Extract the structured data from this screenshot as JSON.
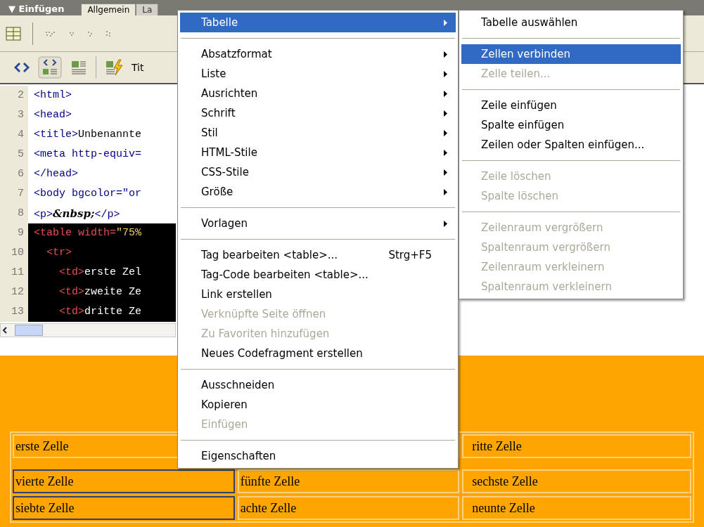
{
  "panel_header": {
    "title": "▼ Einfügen",
    "tabs": [
      {
        "label": "Allgemein",
        "selected": true
      },
      {
        "label": "La",
        "selected": false
      }
    ]
  },
  "toolbar_2": {
    "label": "Tit"
  },
  "code_lines": [
    {
      "number": "2",
      "selected": false,
      "segments": [
        {
          "kind": "tag",
          "text": "<html>"
        }
      ]
    },
    {
      "number": "3",
      "selected": false,
      "segments": [
        {
          "kind": "tag",
          "text": "<head>"
        }
      ]
    },
    {
      "number": "4",
      "selected": false,
      "segments": [
        {
          "kind": "tag",
          "text": "<title>"
        },
        {
          "kind": "text",
          "text": "Unbenannte"
        }
      ]
    },
    {
      "number": "5",
      "selected": false,
      "segments": [
        {
          "kind": "tag",
          "text": "<meta http-equiv="
        }
      ]
    },
    {
      "number": "6",
      "selected": false,
      "segments": [
        {
          "kind": "tag",
          "text": "</head>"
        }
      ]
    },
    {
      "number": "7",
      "selected": false,
      "segments": [
        {
          "kind": "tag",
          "text": "<body bgcolor=\"or"
        }
      ]
    },
    {
      "number": "8",
      "selected": false,
      "segments": [
        {
          "kind": "tag",
          "text": "<p>"
        },
        {
          "kind": "entity",
          "text": "&nbsp;"
        },
        {
          "kind": "tag",
          "text": "</p>"
        }
      ]
    },
    {
      "number": "9",
      "selected": true,
      "segments": [
        {
          "kind": "tag",
          "text": "<table width="
        },
        {
          "kind": "value",
          "text": "\"75%"
        }
      ]
    },
    {
      "number": "10",
      "selected": true,
      "segments": [
        {
          "kind": "tag",
          "text": "  <tr>"
        }
      ]
    },
    {
      "number": "11",
      "selected": true,
      "segments": [
        {
          "kind": "tag",
          "text": "    <td>"
        },
        {
          "kind": "text",
          "text": "erste Zel"
        }
      ]
    },
    {
      "number": "12",
      "selected": true,
      "segments": [
        {
          "kind": "tag",
          "text": "    <td>"
        },
        {
          "kind": "text",
          "text": "zweite Ze"
        }
      ]
    },
    {
      "number": "13",
      "selected": true,
      "segments": [
        {
          "kind": "tag",
          "text": "    <td>"
        },
        {
          "kind": "text",
          "text": "dritte Ze"
        }
      ]
    }
  ],
  "design_table": {
    "rows": [
      [
        {
          "text": "erste Zelle",
          "selected": false
        },
        {
          "selected": false
        },
        {
          "text": "ritte Zelle",
          "selected": false
        }
      ],
      [
        {
          "text": "vierte Zelle",
          "selected": true
        },
        {
          "text": "fünfte Zelle",
          "selected": false
        },
        {
          "text": "sechste Zelle",
          "selected": false
        }
      ],
      [
        {
          "text": "siebte Zelle",
          "selected": true
        },
        {
          "text": "achte Zelle",
          "selected": false
        },
        {
          "text": "neunte Zelle",
          "selected": false
        }
      ]
    ]
  },
  "context_menu": {
    "items": [
      {
        "kind": "item",
        "label": "Tabelle",
        "submenu": true,
        "disabled": false,
        "selected": true
      },
      {
        "kind": "separator"
      },
      {
        "kind": "item",
        "label": "Absatzformat",
        "submenu": true,
        "disabled": false,
        "selected": false
      },
      {
        "kind": "item",
        "label": "Liste",
        "submenu": true,
        "disabled": false,
        "selected": false
      },
      {
        "kind": "item",
        "label": "Ausrichten",
        "submenu": true,
        "disabled": false,
        "selected": false
      },
      {
        "kind": "item",
        "label": "Schrift",
        "submenu": true,
        "disabled": false,
        "selected": false
      },
      {
        "kind": "item",
        "label": "Stil",
        "submenu": true,
        "disabled": false,
        "selected": false
      },
      {
        "kind": "item",
        "label": "HTML-Stile",
        "submenu": true,
        "disabled": false,
        "selected": false
      },
      {
        "kind": "item",
        "label": "CSS-Stile",
        "submenu": true,
        "disabled": false,
        "selected": false
      },
      {
        "kind": "item",
        "label": "Größe",
        "submenu": true,
        "disabled": false,
        "selected": false
      },
      {
        "kind": "separator"
      },
      {
        "kind": "item",
        "label": "Vorlagen",
        "submenu": true,
        "disabled": false,
        "selected": false
      },
      {
        "kind": "separator"
      },
      {
        "kind": "item",
        "label": "Tag bearbeiten <table>...",
        "shortcut": "Strg+F5",
        "submenu": false,
        "disabled": false,
        "selected": false
      },
      {
        "kind": "item",
        "label": "Tag-Code bearbeiten <table>...",
        "submenu": false,
        "disabled": false,
        "selected": false
      },
      {
        "kind": "item",
        "label": "Link erstellen",
        "submenu": false,
        "disabled": false,
        "selected": false
      },
      {
        "kind": "item",
        "label": "Verknüpfte Seite öffnen",
        "submenu": false,
        "disabled": true,
        "selected": false
      },
      {
        "kind": "item",
        "label": "Zu Favoriten hinzufügen",
        "submenu": false,
        "disabled": true,
        "selected": false
      },
      {
        "kind": "item",
        "label": "Neues Codefragment erstellen",
        "submenu": false,
        "disabled": false,
        "selected": false
      },
      {
        "kind": "separator"
      },
      {
        "kind": "item",
        "label": "Ausschneiden",
        "submenu": false,
        "disabled": false,
        "selected": false
      },
      {
        "kind": "item",
        "label": "Kopieren",
        "submenu": false,
        "disabled": false,
        "selected": false
      },
      {
        "kind": "item",
        "label": "Einfügen",
        "submenu": false,
        "disabled": true,
        "selected": false
      },
      {
        "kind": "separator"
      },
      {
        "kind": "item",
        "label": "Eigenschaften",
        "submenu": false,
        "disabled": false,
        "selected": false
      }
    ]
  },
  "submenu": {
    "items": [
      {
        "kind": "item",
        "label": "Tabelle auswählen",
        "disabled": false,
        "selected": false
      },
      {
        "kind": "separator"
      },
      {
        "kind": "item",
        "label": "Zellen verbinden",
        "disabled": false,
        "selected": true
      },
      {
        "kind": "item",
        "label": "Zelle teilen...",
        "disabled": true,
        "selected": false
      },
      {
        "kind": "separator"
      },
      {
        "kind": "item",
        "label": "Zeile einfügen",
        "disabled": false,
        "selected": false
      },
      {
        "kind": "item",
        "label": "Spalte einfügen",
        "disabled": false,
        "selected": false
      },
      {
        "kind": "item",
        "label": "Zeilen oder Spalten einfügen...",
        "disabled": false,
        "selected": false
      },
      {
        "kind": "separator"
      },
      {
        "kind": "item",
        "label": "Zeile löschen",
        "disabled": true,
        "selected": false
      },
      {
        "kind": "item",
        "label": "Spalte löschen",
        "disabled": true,
        "selected": false
      },
      {
        "kind": "separator"
      },
      {
        "kind": "item",
        "label": "Zeilenraum vergrößern",
        "disabled": true,
        "selected": false
      },
      {
        "kind": "item",
        "label": "Spaltenraum vergrößern",
        "disabled": true,
        "selected": false
      },
      {
        "kind": "item",
        "label": "Zeilenraum verkleinern",
        "disabled": true,
        "selected": false
      },
      {
        "kind": "item",
        "label": "Spaltenraum verkleinern",
        "disabled": true,
        "selected": false
      }
    ]
  }
}
